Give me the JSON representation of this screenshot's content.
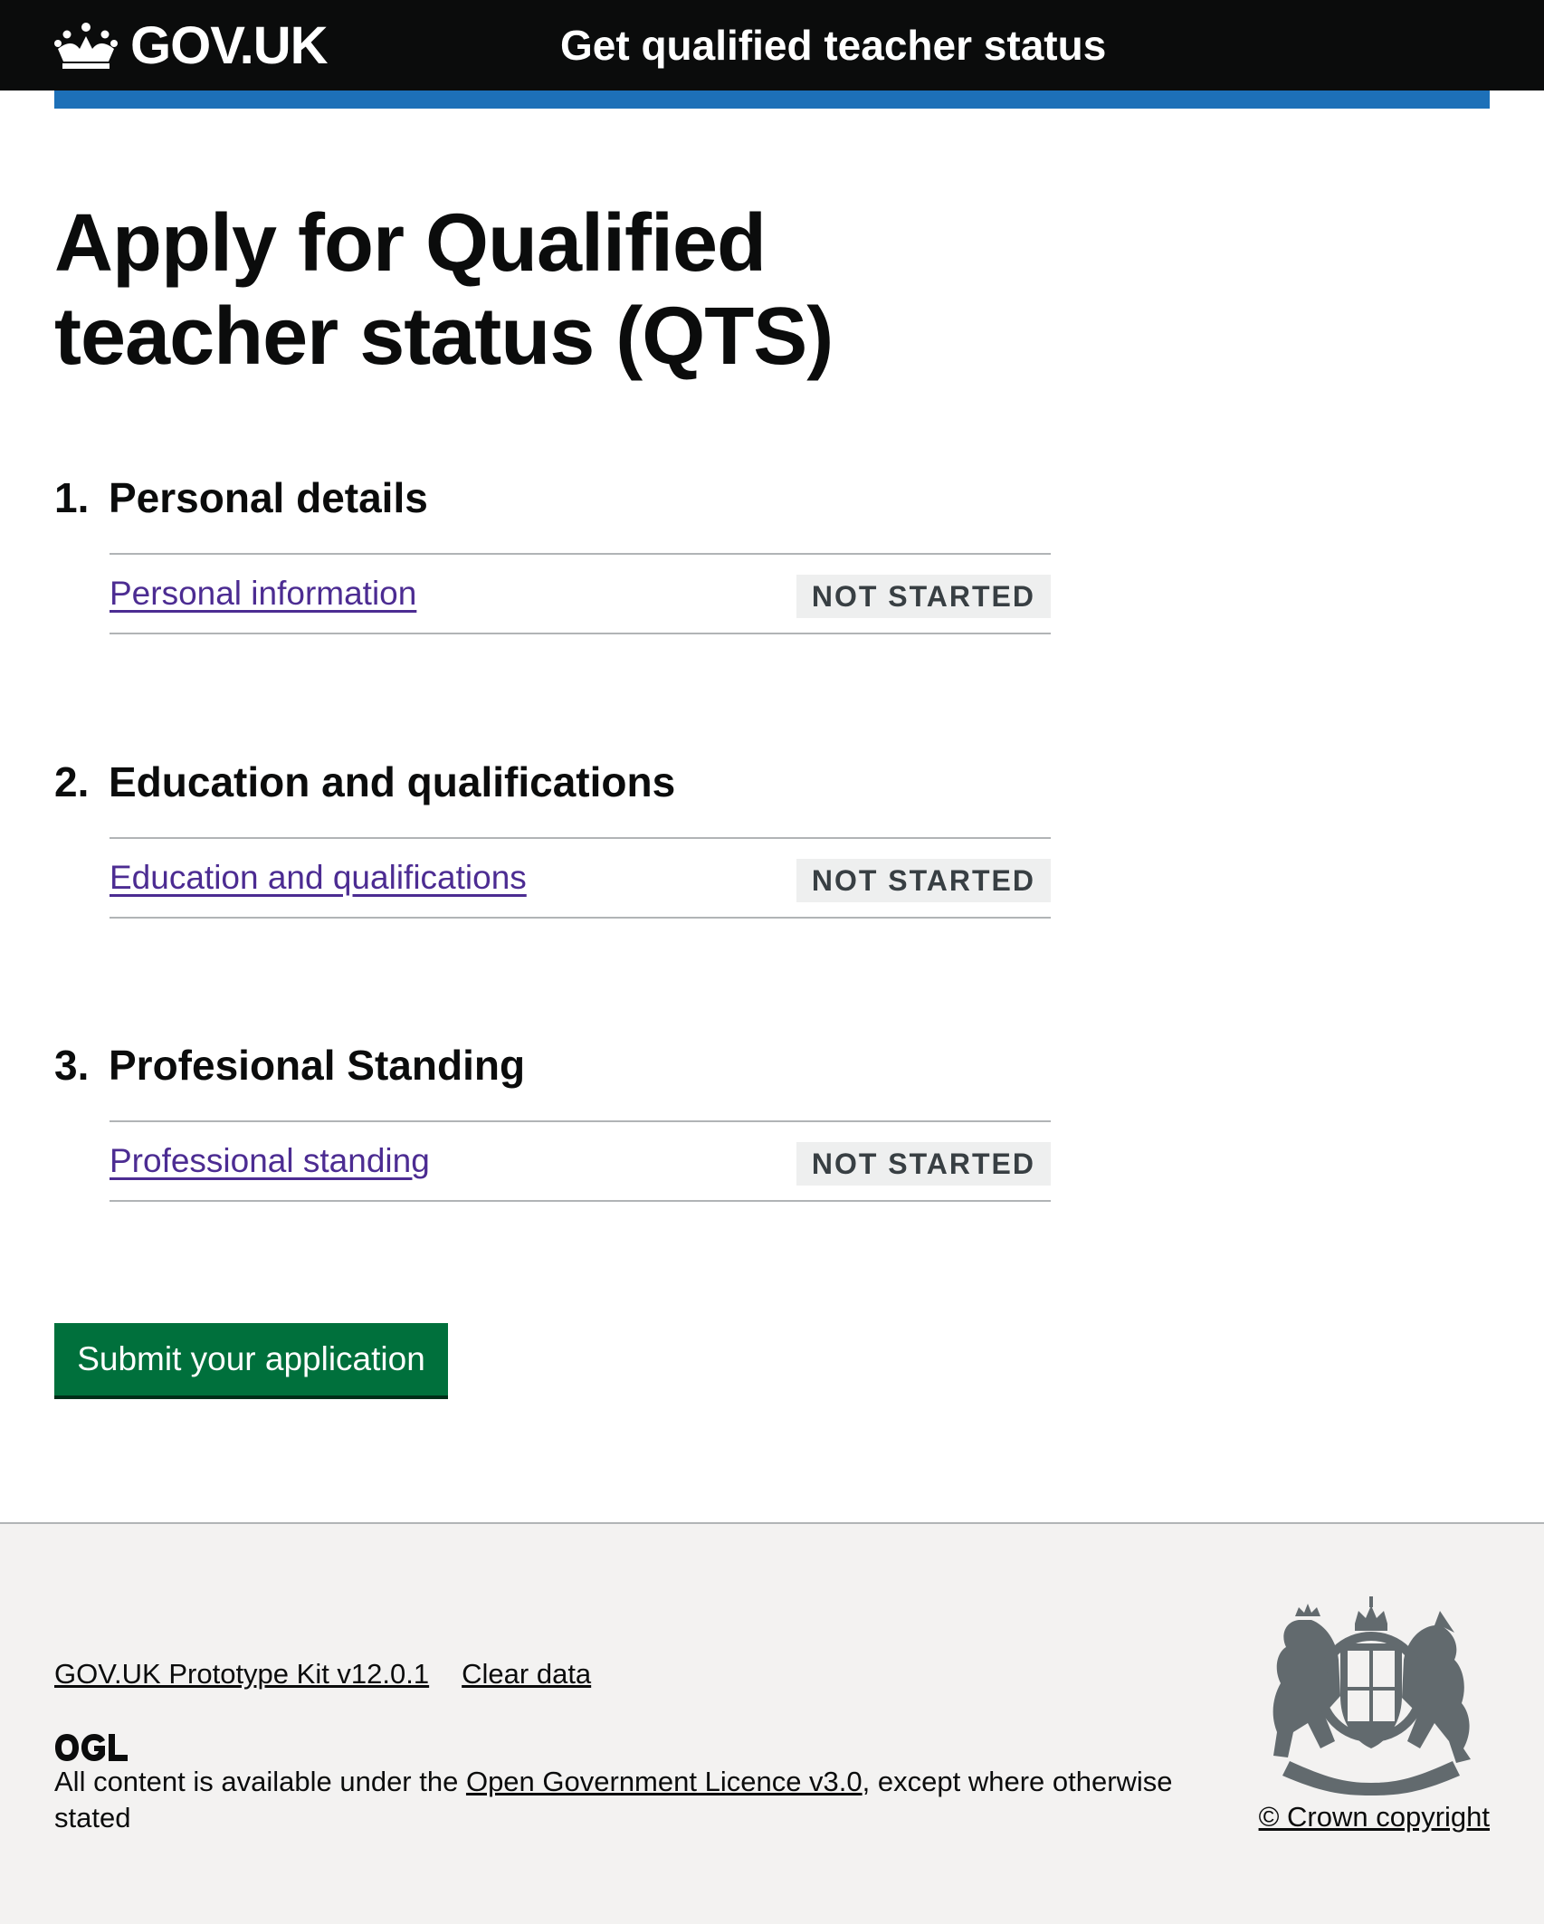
{
  "header": {
    "logo_text": "GOV.UK",
    "service_name": "Get qualified teacher status",
    "icon": "crown-icon"
  },
  "colors": {
    "header_bg": "#0b0c0c",
    "accent_blue": "#1d70b8",
    "link": "#4c2c92",
    "button": "#00703c",
    "tag_bg": "#eeefef",
    "footer_bg": "#f3f2f1"
  },
  "main": {
    "title": "Apply for Qualified teacher status (QTS)",
    "sections": [
      {
        "number": "1.",
        "heading": "Personal details",
        "task": "Personal information",
        "status": "NOT STARTED"
      },
      {
        "number": "2.",
        "heading": "Education and qualifications",
        "task": "Education and qualifications",
        "status": "NOT STARTED"
      },
      {
        "number": "3.",
        "heading": "Profesional Standing",
        "task": "Professional standing",
        "status": "NOT STARTED"
      }
    ],
    "submit_label": "Submit your application"
  },
  "footer": {
    "links": [
      "GOV.UK Prototype Kit v12.0.1",
      "Clear data"
    ],
    "licence_prefix": "All content is available under the ",
    "licence_link": "Open Government Licence v3.0",
    "licence_suffix": ", except where otherwise stated",
    "copyright": "© Crown copyright",
    "ogl_icon": "ogl-icon",
    "crest_icon": "royal-crest-icon"
  }
}
